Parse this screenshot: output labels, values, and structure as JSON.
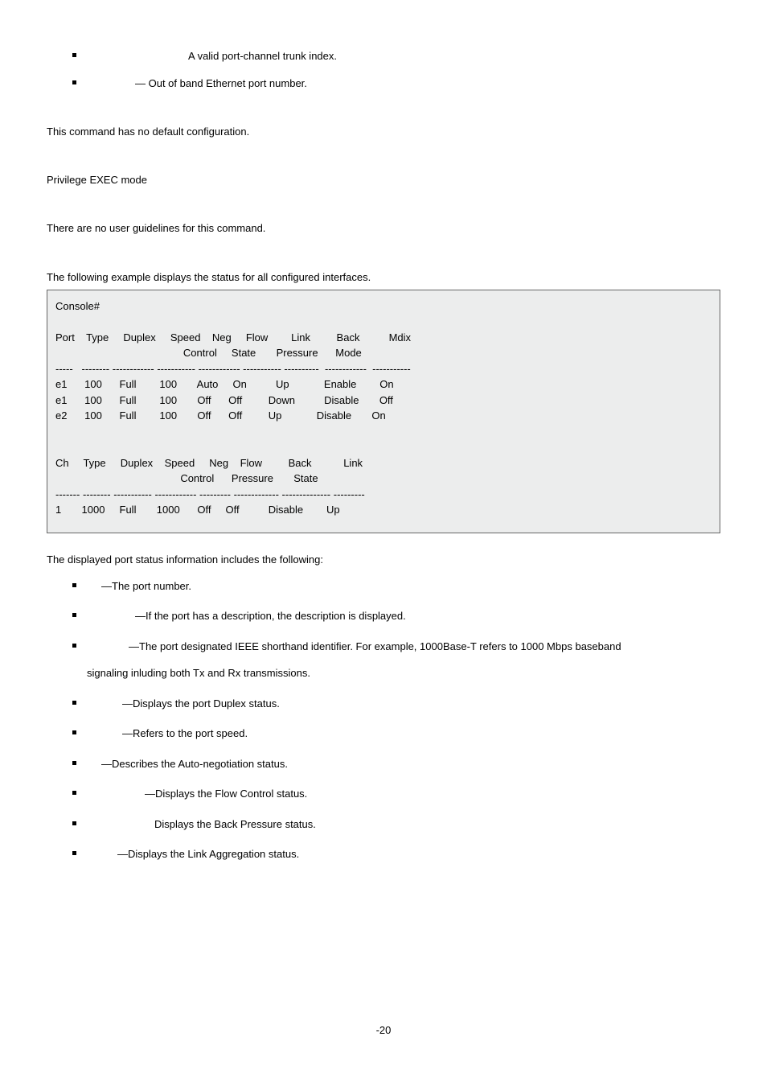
{
  "top_bullets": [
    {
      "indent": "indent-a",
      "text": "A valid port-channel trunk index."
    },
    {
      "indent": "indent-b",
      "text": "— Out of band Ethernet port number."
    }
  ],
  "default_config": "This command has no default configuration.",
  "mode": "Privilege EXEC mode",
  "guidelines": "There are no user guidelines for this command.",
  "example_intro": "The following example displays the status for all configured interfaces.",
  "console": {
    "prompt": "Console#",
    "hdr1": {
      "c0": "Port",
      "c1": "Type",
      "c2": "Duplex",
      "c3": "Speed",
      "c4": "Neg",
      "c5": "Flow",
      "c6": "Link",
      "c7": "Back",
      "c8": "Mdix"
    },
    "hdr1b": {
      "c5": "Control",
      "c6": "State",
      "c7": "Pressure",
      "c8": "Mode"
    },
    "sep1": {
      "c0": "-----",
      "c1": "--------",
      "c2": "------------",
      "c3": "-----------",
      "c4": "------------",
      "c5": "-----------",
      "c6": "----------",
      "c7": "------------",
      "c8": "-----------"
    },
    "rows": [
      {
        "c0": "e1",
        "c1": "100",
        "c2": "Full",
        "c3": "100",
        "c4": "Auto",
        "c5": "On",
        "c6": "Up",
        "c7": "Enable",
        "c8": "On"
      },
      {
        "c0": "e1",
        "c1": "100",
        "c2": "Full",
        "c3": "100",
        "c4": "Off",
        "c5": "Off",
        "c6": "Down",
        "c7": "Disable",
        "c8": "Off"
      },
      {
        "c0": "e2",
        "c1": "100",
        "c2": "Full",
        "c3": "100",
        "c4": "Off",
        "c5": "Off",
        "c6": "Up",
        "c7": "Disable",
        "c8": "On"
      }
    ],
    "hdr2": {
      "c0": "Ch",
      "c1": "Type",
      "c2": "Duplex",
      "c3": "Speed",
      "c4": "Neg",
      "c5": "Flow",
      "c6": "Back",
      "c7": "Link"
    },
    "hdr2b": {
      "c5": "Control",
      "c6": "Pressure",
      "c7": "State"
    },
    "sep2": {
      "c0": "-------",
      "c1": "--------",
      "c2": "-----------",
      "c3": "------------",
      "c4": "---------",
      "c5": "-------------",
      "c6": "--------------",
      "c7": "---------"
    },
    "row2": {
      "c0": "1",
      "c1": "1000",
      "c2": "Full",
      "c3": "1000",
      "c4": "Off",
      "c5": "Off",
      "c6": "Disable",
      "c7": "Up"
    }
  },
  "footer_intro": "The displayed port status information includes the following:",
  "descriptions": [
    {
      "indent": "indent-c",
      "text": "—The port number."
    },
    {
      "indent": "indent-b",
      "text": "—If the port has a description, the description is displayed."
    },
    {
      "indent": "indent-d",
      "text": "—The port designated IEEE shorthand identifier. For example, 1000Base-T refers to 1000 Mbps baseband",
      "sub": "signaling inluding both Tx and Rx transmissions."
    },
    {
      "indent": "indent-e",
      "text": "—Displays the port Duplex status."
    },
    {
      "indent": "indent-e",
      "text": "—Refers to the port speed."
    },
    {
      "indent": "indent-c",
      "text": "—Describes the Auto-negotiation status."
    },
    {
      "indent": "indent-h",
      "text": "—Displays the Flow Control status."
    },
    {
      "indent": "indent-i",
      "text": "Displays the Back Pressure status."
    },
    {
      "indent": "indent-g",
      "text": "—Displays the Link Aggregation status."
    }
  ],
  "pagenum": "-20"
}
